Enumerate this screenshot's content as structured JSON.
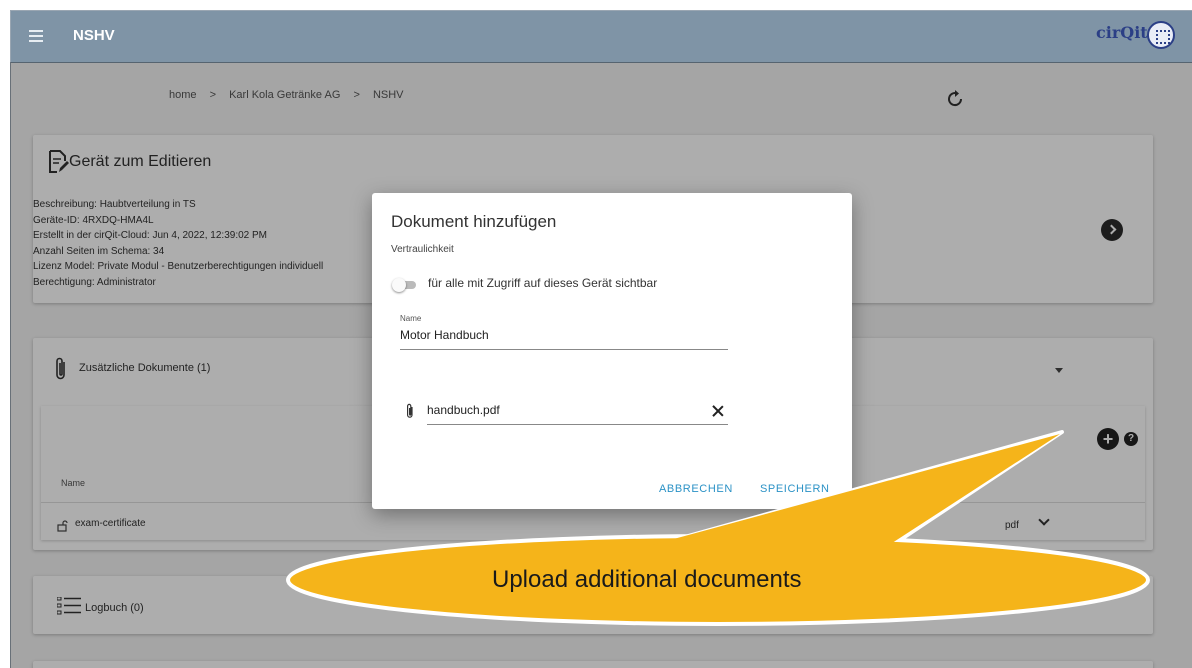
{
  "topbar": {
    "title": "NSHV",
    "logo": "cirQit",
    "menu_icon": "hamburger-menu-icon"
  },
  "breadcrumb": [
    "home",
    ">",
    "Karl Kola Getränke AG",
    ">",
    "NSHV"
  ],
  "device": {
    "heading": "Gerät zum Editieren",
    "details": [
      "Beschreibung: Haubtverteilung in TS",
      "Geräte-ID: 4RXDQ-HMA4L",
      "Erstellt in der cirQit-Cloud: Jun 4, 2022, 12:39:02 PM",
      "Anzahl Seiten im Schema: 34",
      "Lizenz Model: Private Modul - Benutzerberechtigungen individuell",
      "Berechtigung: Administrator"
    ]
  },
  "documents": {
    "title": "Zusätzliche Dokumente (1)",
    "add_label": "+",
    "help_label": "?",
    "column_name": "Name",
    "rows": [
      {
        "name": "exam-certificate",
        "type": "pdf"
      }
    ]
  },
  "logbook": {
    "title": "Logbuch (0)"
  },
  "dialog": {
    "title": "Dokument hinzufügen",
    "confidentiality_label": "Vertraulichkeit",
    "toggle_label": "für alle mit Zugriff auf dieses Gerät sichtbar",
    "toggle_on": false,
    "name_label": "Name",
    "name_value": "Motor Handbuch",
    "file_value": "handbuch.pdf",
    "cancel_label": "ABBRECHEN",
    "save_label": "SPEICHERN"
  },
  "callout": {
    "text": "Upload additional documents",
    "fill_color": "#f5b41a"
  },
  "colors": {
    "topbar": "#7f94a6",
    "accent": "#2b92c6"
  }
}
